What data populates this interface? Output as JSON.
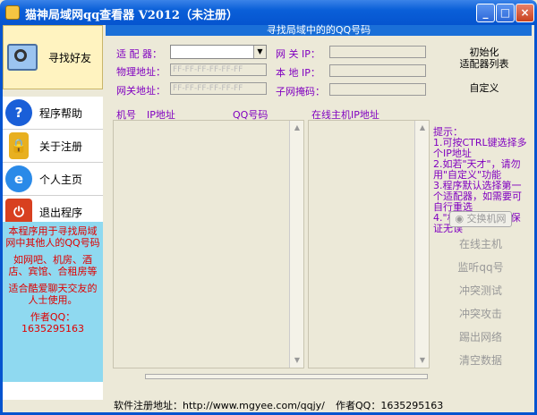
{
  "window": {
    "title": "猫神局域网qq查看器 V2012（未注册）"
  },
  "sidebar": {
    "top": {
      "label": "寻找好友",
      "icon": "search-monitor-icon"
    },
    "items": [
      {
        "label": "程序帮助",
        "icon": "help-icon",
        "color": "#1A5FD8"
      },
      {
        "label": "关于注册",
        "icon": "lock-icon",
        "color": "#E8B020"
      },
      {
        "label": "个人主页",
        "icon": "ie-icon",
        "color": "#2A8AE8"
      },
      {
        "label": "退出程序",
        "icon": "exit-icon",
        "color": "#D84020"
      }
    ],
    "info": [
      "本程序用于寻找局域网中其他人的QQ号码",
      "如网吧、机房、酒店、宾馆、合租房等",
      "适合酷爱聊天交友的人士使用。",
      "作者QQ：1635295163"
    ]
  },
  "main": {
    "header": "寻找局域中的的QQ号码",
    "adapter_label": "适 配 器：",
    "mac_label": "物理地址：",
    "gateway_addr_label": "网关地址：",
    "mac_placeholder": "FF-FF-FF-FF-FF-FF",
    "gateway_mac_placeholder": "FF-FF-FF-FF-FF-FF",
    "gateway_ip_label": "网 关 IP：",
    "local_ip_label": "本 地 IP：",
    "subnet_label": "子网掩码：",
    "init_label": "初始化\n适配器列表",
    "custom_label": "自定义",
    "columns": [
      "机号",
      "IP地址",
      "QQ号码"
    ],
    "online_col": "在线主机IP地址",
    "tips_title": "提示：",
    "tips": [
      "1.可按CTRL键选择多个IP地址",
      "2.如若\"天才\"，请勿用\"自定义\"功能",
      "3.程序默认选择第一个适配器，如需要可自行重选",
      "4.\"机号\"是推荐不保证无误"
    ],
    "exchange_btn": "交换机网",
    "actions": [
      "在线主机",
      "监听qq号",
      "冲突测试",
      "冲突攻击",
      "踢出网络",
      "清空数据"
    ]
  },
  "footer": {
    "site": "软件注册地址：http://www.mgyee.com/qqjy/",
    "author": "作者QQ：1635295163"
  }
}
